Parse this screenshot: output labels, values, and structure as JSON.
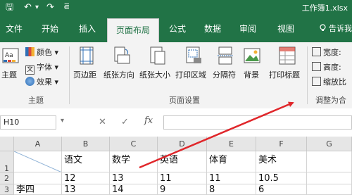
{
  "window": {
    "title": "工作簿1.xlsx",
    "qat": [
      {
        "icon": "save-icon",
        "glyph": "🖫"
      },
      {
        "icon": "undo-icon",
        "glyph": "↶"
      },
      {
        "icon": "undo-dropdown-icon",
        "glyph": "▾"
      },
      {
        "icon": "redo-icon",
        "glyph": "↷"
      },
      {
        "icon": "customize-qat-icon",
        "glyph": "⋷"
      }
    ]
  },
  "tabs": [
    {
      "label": "文件",
      "active": false
    },
    {
      "label": "开始",
      "active": false
    },
    {
      "label": "插入",
      "active": false
    },
    {
      "label": "页面布局",
      "active": true
    },
    {
      "label": "公式",
      "active": false
    },
    {
      "label": "数据",
      "active": false
    },
    {
      "label": "审阅",
      "active": false
    },
    {
      "label": "视图",
      "active": false
    }
  ],
  "tell_me": "告诉我",
  "ribbon": {
    "theme_group": {
      "label": "主题",
      "theme_button": "主题",
      "colors": "颜色",
      "fonts": "字体",
      "effects": "效果"
    },
    "page_setup_group": {
      "label": "页面设置",
      "buttons": [
        "页边距",
        "纸张方向",
        "纸张大小",
        "打印区域",
        "分隔符",
        "背景",
        "打印标题"
      ]
    },
    "scale_group": {
      "label": "调整为合",
      "width": "宽度:",
      "height": "高度:",
      "scale": "缩放比"
    }
  },
  "formula_bar": {
    "name_box": "H10",
    "cancel_glyph": "✕",
    "enter_glyph": "✓",
    "fx": "fx",
    "value": ""
  },
  "sheet": {
    "columns": [
      "A",
      "B",
      "C",
      "D",
      "E",
      "F",
      "G"
    ],
    "rows": [
      {
        "header": "1",
        "cells": [
          "",
          "语文",
          "数学",
          "英语",
          "体育",
          "美术",
          ""
        ]
      },
      {
        "header": "2",
        "cells": [
          "",
          "12",
          "13",
          "11",
          "11",
          "10.5",
          ""
        ]
      },
      {
        "header": "3",
        "cells": [
          "李四",
          "13",
          "14",
          "9",
          "8",
          "6",
          ""
        ]
      }
    ]
  },
  "annotation": {
    "color": "#e0272b"
  },
  "colors": {
    "accent": "#217346",
    "ribbon_bg": "#f3f3f3"
  }
}
